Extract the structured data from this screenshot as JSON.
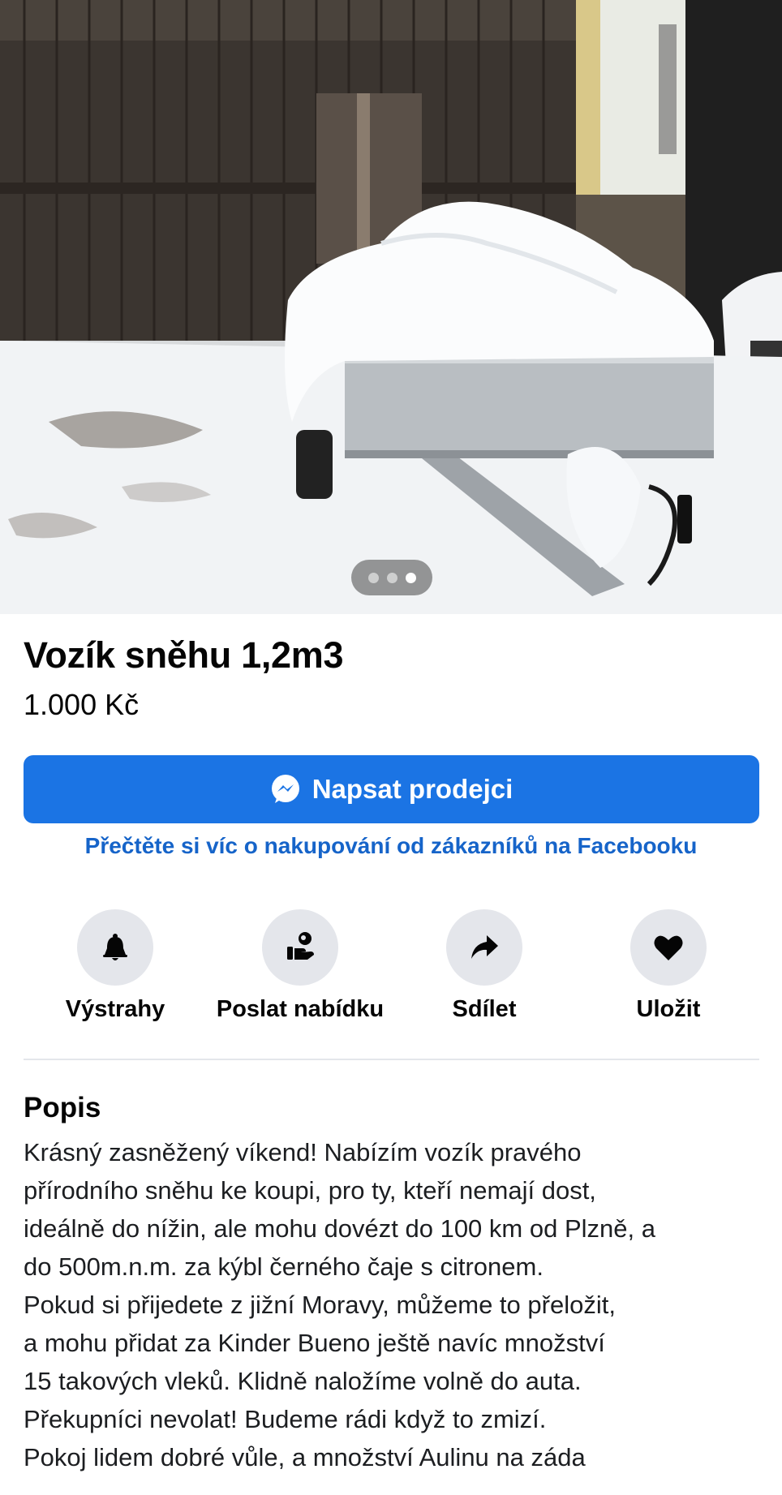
{
  "listing": {
    "title": "Vozík sněhu 1,2m3",
    "price": "1.000 Kč",
    "photo_count": 3,
    "photo_active_index": 2
  },
  "buttons": {
    "message_seller": "Napsat prodejci",
    "learn_more": "Přečtěte si víc o nakupování od zákazníků na Facebooku"
  },
  "actions": [
    {
      "label": "Výstrahy",
      "icon": "bell-icon"
    },
    {
      "label": "Poslat nabídku",
      "icon": "offer-icon"
    },
    {
      "label": "Sdílet",
      "icon": "share-icon"
    },
    {
      "label": "Uložit",
      "icon": "heart-icon"
    }
  ],
  "description": {
    "heading": "Popis",
    "lines": [
      "Krásný zasněžený víkend! Nabízím vozík pravého",
      "přírodního sněhu ke koupi, pro ty, kteří nemají dost,",
      "ideálně do nížin, ale mohu dovézt do 100 km od Plzně, a",
      "do 500m.n.m. za kýbl černého čaje s citronem.",
      "Pokud si přijedete z jižní Moravy, můžeme to přeložit,",
      "a mohu přidat za Kinder Bueno ještě navíc množství",
      "15 takových vleků. Klidně naložíme volně do auta.",
      "Překupníci nevolat! Budeme rádi když to zmizí.",
      "Pokoj lidem dobré vůle, a množství Aulinu na záda"
    ]
  },
  "colors": {
    "primary_button": "#1b74e4",
    "link": "#1664c9",
    "icon_circle": "#e4e6eb",
    "text": "#050505"
  }
}
